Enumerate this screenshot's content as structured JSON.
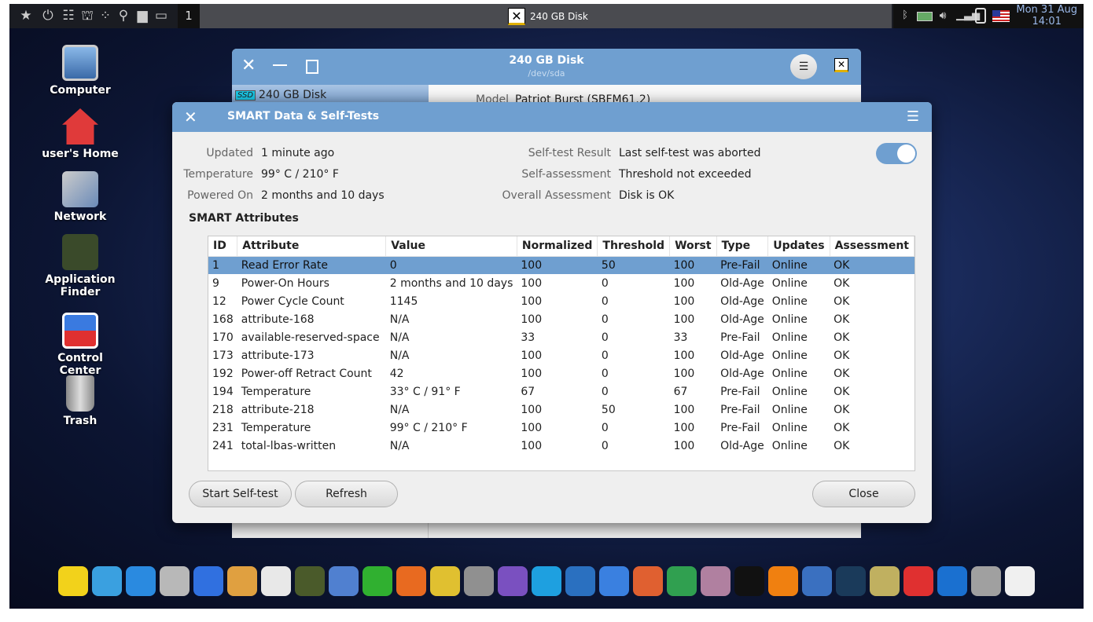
{
  "panel": {
    "workspace": "1",
    "task_title": "240 GB Disk",
    "clock_date": "Mon 31 Aug",
    "clock_time": "14:01",
    "left_icons": [
      "star-icon",
      "power-icon",
      "toggle-settings-icon",
      "binoculars-icon",
      "apps-grid-icon",
      "search-icon",
      "folder-icon",
      "show-desktop-icon"
    ],
    "tray_icons": [
      "bluetooth-icon",
      "battery-icon",
      "volume-icon",
      "signal-icon",
      "clipboard-icon",
      "us-flag-icon"
    ]
  },
  "desktop": {
    "icons": [
      {
        "label": "Computer"
      },
      {
        "label": "user's Home"
      },
      {
        "label": "Network"
      },
      {
        "label": "Application Finder"
      },
      {
        "label": "Control Center"
      },
      {
        "label": "Trash"
      }
    ]
  },
  "bg_window": {
    "title": "240 GB Disk",
    "subtitle": "/dev/sda",
    "sidebar_item": "240 GB Disk",
    "ssd_badge": "SSD",
    "model_label": "Model",
    "model_value": "Patriot Burst (SBFM61.2)"
  },
  "dialog": {
    "title": "SMART Data & Self-Tests",
    "info_left": [
      {
        "label": "Updated",
        "value": "1 minute ago"
      },
      {
        "label": "Temperature",
        "value": "99° C / 210° F"
      },
      {
        "label": "Powered On",
        "value": "2 months and 10 days"
      }
    ],
    "info_right": [
      {
        "label": "Self-test Result",
        "value": "Last self-test was aborted"
      },
      {
        "label": "Self-assessment",
        "value": "Threshold not exceeded"
      },
      {
        "label": "Overall Assessment",
        "value": "Disk is OK"
      }
    ],
    "smart_enabled": true,
    "section": "SMART Attributes",
    "columns": [
      "ID",
      "Attribute",
      "Value",
      "Normalized",
      "Threshold",
      "Worst",
      "Type",
      "Updates",
      "Assessment"
    ],
    "rows": [
      [
        "1",
        "Read Error Rate",
        "0",
        "100",
        "50",
        "100",
        "Pre-Fail",
        "Online",
        "OK"
      ],
      [
        "9",
        "Power-On Hours",
        "2 months and 10 days",
        "100",
        "0",
        "100",
        "Old-Age",
        "Online",
        "OK"
      ],
      [
        "12",
        "Power Cycle Count",
        "1145",
        "100",
        "0",
        "100",
        "Old-Age",
        "Online",
        "OK"
      ],
      [
        "168",
        "attribute-168",
        "N/A",
        "100",
        "0",
        "100",
        "Old-Age",
        "Online",
        "OK"
      ],
      [
        "170",
        "available-reserved-space",
        "N/A",
        "33",
        "0",
        "33",
        "Pre-Fail",
        "Online",
        "OK"
      ],
      [
        "173",
        "attribute-173",
        "N/A",
        "100",
        "0",
        "100",
        "Old-Age",
        "Online",
        "OK"
      ],
      [
        "192",
        "Power-off Retract Count",
        "42",
        "100",
        "0",
        "100",
        "Old-Age",
        "Online",
        "OK"
      ],
      [
        "194",
        "Temperature",
        "33° C / 91° F",
        "67",
        "0",
        "67",
        "Pre-Fail",
        "Online",
        "OK"
      ],
      [
        "218",
        "attribute-218",
        "N/A",
        "100",
        "50",
        "100",
        "Pre-Fail",
        "Online",
        "OK"
      ],
      [
        "231",
        "Temperature",
        "99° C / 210° F",
        "100",
        "0",
        "100",
        "Pre-Fail",
        "Online",
        "OK"
      ],
      [
        "241",
        "total-lbas-written",
        "N/A",
        "100",
        "0",
        "100",
        "Old-Age",
        "Online",
        "OK"
      ]
    ],
    "selected_row": 0,
    "buttons": {
      "start": "Start Self-test",
      "refresh": "Refresh",
      "close": "Close"
    }
  },
  "dock": [
    {
      "name": "favorites",
      "color": "#f2d21b"
    },
    {
      "name": "apps",
      "color": "#3aa0e0"
    },
    {
      "name": "desktop",
      "color": "#2a8ae0"
    },
    {
      "name": "file-cabinet",
      "color": "#b8b8b8"
    },
    {
      "name": "control-center",
      "color": "#3070e0"
    },
    {
      "name": "color-palette",
      "color": "#e0a040"
    },
    {
      "name": "app-store",
      "color": "#e8e8e8"
    },
    {
      "name": "binoculars",
      "color": "#4a5a2a"
    },
    {
      "name": "rocket",
      "color": "#5080d0"
    },
    {
      "name": "pipe",
      "color": "#30b030"
    },
    {
      "name": "firefox",
      "color": "#e86a20"
    },
    {
      "name": "chrome",
      "color": "#e0c030"
    },
    {
      "name": "pro",
      "color": "#909090"
    },
    {
      "name": "viber",
      "color": "#7a50c0"
    },
    {
      "name": "skype",
      "color": "#1ea0e0"
    },
    {
      "name": "mail",
      "color": "#2a70c0"
    },
    {
      "name": "writer",
      "color": "#3a80e0"
    },
    {
      "name": "presentation",
      "color": "#e06030"
    },
    {
      "name": "spreadsheet",
      "color": "#30a050"
    },
    {
      "name": "webcam",
      "color": "#b080a0"
    },
    {
      "name": "amazon",
      "color": "#111111"
    },
    {
      "name": "vlc",
      "color": "#f08010"
    },
    {
      "name": "qbittorrent",
      "color": "#3a70c0"
    },
    {
      "name": "steam",
      "color": "#1a3a5a"
    },
    {
      "name": "backup",
      "color": "#c0b060"
    },
    {
      "name": "anydesk",
      "color": "#e03030"
    },
    {
      "name": "teamviewer",
      "color": "#1a70d0"
    },
    {
      "name": "trash",
      "color": "#a0a0a0"
    },
    {
      "name": "system-tools",
      "color": "#f0f0f0"
    }
  ]
}
